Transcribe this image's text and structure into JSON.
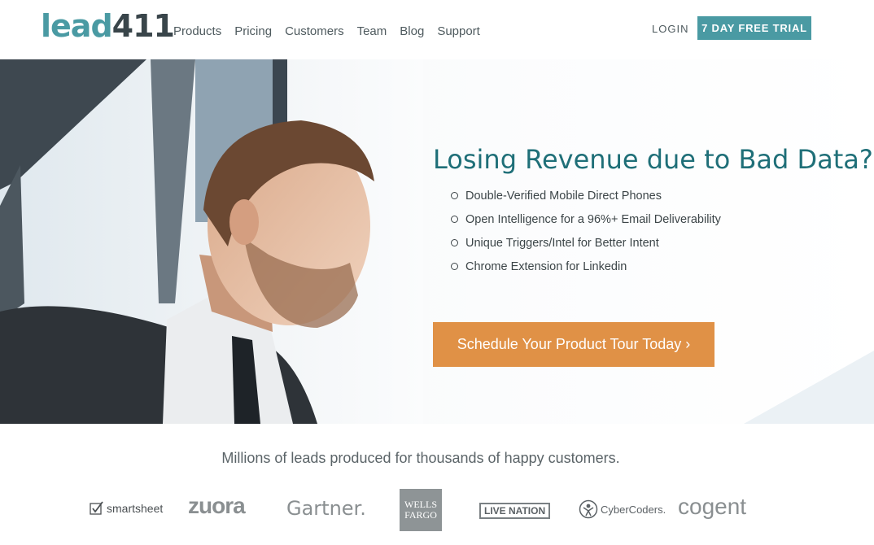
{
  "header": {
    "logo": {
      "text": "lead",
      "num": "411"
    },
    "nav": [
      "Products",
      "Pricing",
      "Customers",
      "Team",
      "Blog",
      "Support"
    ],
    "login": "LOGIN",
    "trial": "7 DAY FREE TRIAL"
  },
  "hero": {
    "title": "Losing Revenue due to Bad Data?",
    "bullets": [
      "Double-Verified Mobile Direct Phones",
      "Open Intelligence for a 96%+ Email Deliverability",
      "Unique Triggers/Intel for Better Intent",
      "Chrome Extension for Linkedin"
    ],
    "cta": "Schedule Your Product Tour Today ›"
  },
  "customers": {
    "tagline": "Millions of leads produced for thousands of happy customers.",
    "logos": {
      "smartsheet": "smartsheet",
      "zuora": "zuora",
      "gartner": "Gartner.",
      "wells_fargo_1": "WELLS",
      "wells_fargo_2": "FARGO",
      "live_nation": "LIVE NATION",
      "cybercoders": "CyberCoders.",
      "cogent": "cogent"
    }
  },
  "colors": {
    "brand": "#4a9aa3",
    "cta": "#e09146",
    "title": "#1f6f78"
  }
}
